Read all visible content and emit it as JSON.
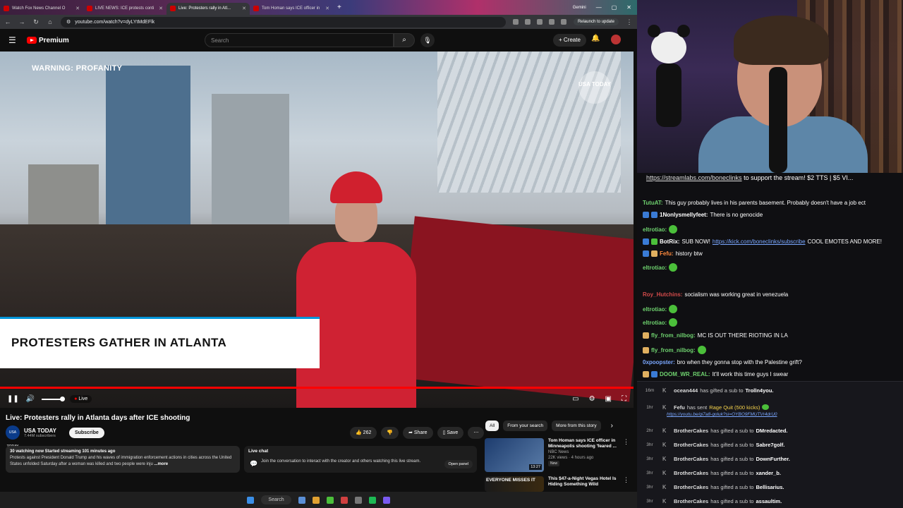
{
  "browser": {
    "tabs": [
      {
        "label": "Watch Fox News Channel O"
      },
      {
        "label": "LIVE NEWS: ICE protests conti"
      },
      {
        "label": "Live: Protesters rally in Atl..."
      },
      {
        "label": "Tom Homan says ICE officer in"
      }
    ],
    "right_tab": "Gemini",
    "relaunch": "Relaunch to update",
    "url": "youtube.com/watch?v=dyLYtMdEFlk"
  },
  "youtube": {
    "brand": "Premium",
    "search_placeholder": "Search",
    "create_label": "+ Create",
    "video": {
      "warning": "WARNING: PROFANITY",
      "watermark": "USA TODAY",
      "lower_third": "PROTESTERS GATHER IN ATLANTA",
      "live_label": "Live"
    },
    "title": "Live: Protesters rally in Atlanta days after ICE shooting",
    "channel": {
      "avatar_text": "USA TODAY",
      "name": "USA TODAY",
      "subs": "7.44M subscribers",
      "subscribe": "Subscribe"
    },
    "actions": {
      "likes": "262",
      "share": "Share",
      "save": "Save",
      "more": "⋯"
    },
    "description": {
      "stats": "30 watching now  Started streaming 101 minutes ago",
      "text": "Protests against President Donald Trump and his waves of immigration enforcement actions in cities across the United States unfolded Saturday after a woman was killed and two people were inju",
      "more": "...more"
    },
    "live_chat": {
      "title": "Live chat",
      "text": "Join the conversation to interact with the creator and others watching this live stream.",
      "button": "Open panel"
    },
    "chips": [
      {
        "label": "All",
        "selected": true
      },
      {
        "label": "From your search",
        "selected": false
      },
      {
        "label": "More from this story",
        "selected": false
      }
    ],
    "recommendations": [
      {
        "title": "Tom Homan says ICE officer in Minneapolis shooting 'feared ...",
        "channel": "NBC News",
        "meta": "22K views · 4 hours ago",
        "badge": "New",
        "duration": "13:27"
      },
      {
        "title": "This $47-a-Night Vegas Hotel Is Hiding Something Wild",
        "thumb_text": "EVERYONE MISSES IT"
      }
    ],
    "taskbar_search": "Search"
  },
  "stream": {
    "chat_top": {
      "link": "https://streamlabs.com/boneclinks",
      "rest": "to support the stream! $2 TTS | $5 VI..."
    },
    "messages": [
      {
        "user": "TutuAT:",
        "text": "This guy probably lives in his parents basement. Probably doesn't have a job ect",
        "color": "#6fd36f",
        "badges": []
      },
      {
        "user": "1Nonlysmellyfeet:",
        "text": "There is no genocide",
        "color": "#ffffff",
        "badges": [
          "#3a7bd5",
          "#3a7bd5"
        ]
      },
      {
        "user": "eltrotiao:",
        "text": "",
        "color": "#6fd36f",
        "badges": [],
        "emote": true
      },
      {
        "user": "BotRix:",
        "text": "SUB NOW!",
        "link": "https://kick.com/boneclinks/subscribe",
        "text2": "COOL EMOTES AND MORE!",
        "color": "#ffffff",
        "badges": [
          "#3a7bd5",
          "#4bbf3a"
        ]
      },
      {
        "user": "Fefu:",
        "text": "history btw",
        "color": "#ff8a3d",
        "badges": [
          "#3a7bd5",
          "#e0b060"
        ]
      },
      {
        "user": "eltrotiao:",
        "text": "",
        "color": "#6fd36f",
        "badges": [],
        "emote": true
      },
      {
        "user": "Roy_Hutchins:",
        "text": "socialism was working great in venezuela",
        "color": "#d14a4a",
        "badges": []
      },
      {
        "user": "eltrotiao:",
        "text": "",
        "color": "#6fd36f",
        "badges": [],
        "emote": true
      },
      {
        "user": "eltrotiao:",
        "text": "",
        "color": "#6fd36f",
        "badges": [],
        "emote": true
      },
      {
        "user": "fly_from_nilbog:",
        "text": "MC IS OUT THERE RIOTING IN LA",
        "color": "#6fd36f",
        "badges": [
          "#e0b060"
        ]
      },
      {
        "user": "fly_from_nilbog:",
        "text": "",
        "color": "#6fd36f",
        "badges": [
          "#e0b060"
        ],
        "emote": true
      },
      {
        "user": "0xpoopster:",
        "text": "bro when they gonna stop with the Palestine grift?",
        "color": "#7aa7ff",
        "badges": []
      },
      {
        "user": "DOOM_WR_REAL:",
        "text": "It'll work this time guys I swear",
        "color": "#6fd36f",
        "badges": [
          "#e0b060",
          "#3a7bd5"
        ]
      }
    ],
    "events": [
      {
        "time": "16m",
        "who": "ocean444",
        "text": "has gifted a sub to",
        "target": "Trolln4you."
      },
      {
        "time": "1hr",
        "who": "Fefu",
        "text": "has sent",
        "gold": "Rage Quit (500 kicks)",
        "link": "https://youtu.be/qi7a8-goluk?si=OYBO9FMUTVr4drU0"
      },
      {
        "time": "2hr",
        "who": "BrotherCakes",
        "text": "has gifted a sub to",
        "target": "DMredacted."
      },
      {
        "time": "3hr",
        "who": "BrotherCakes",
        "text": "has gifted a sub to",
        "target": "Sabre7golf."
      },
      {
        "time": "3hr",
        "who": "BrotherCakes",
        "text": "has gifted a sub to",
        "target": "DownFurther."
      },
      {
        "time": "3hr",
        "who": "BrotherCakes",
        "text": "has gifted a sub to",
        "target": "xander_b."
      },
      {
        "time": "3hr",
        "who": "BrotherCakes",
        "text": "has gifted a sub to",
        "target": "Bellisarius."
      },
      {
        "time": "3hr",
        "who": "BrotherCakes",
        "text": "has gifted a sub to",
        "target": "assaultim."
      }
    ]
  }
}
